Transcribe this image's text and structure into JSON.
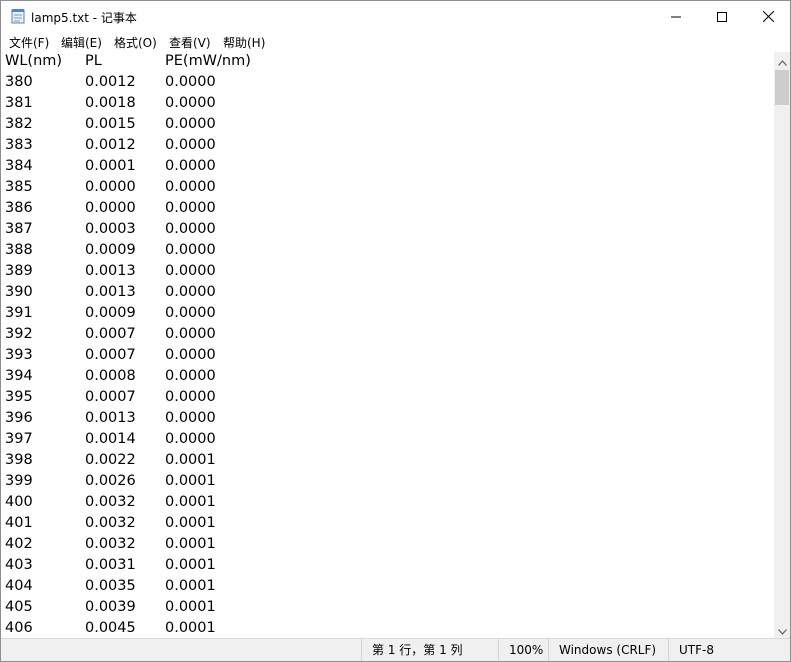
{
  "window": {
    "title": "lamp5.txt - 记事本",
    "icon": "notepad-icon",
    "controls": [
      "minimize-icon",
      "maximize-icon",
      "close-icon"
    ]
  },
  "menu": [
    "文件(F)",
    "编辑(E)",
    "格式(O)",
    "查看(V)",
    "帮助(H)"
  ],
  "document": {
    "header": [
      "WL(nm)",
      "PL",
      "PE(mW/nm)"
    ],
    "rows": [
      [
        "380",
        "0.0012",
        "0.0000"
      ],
      [
        "381",
        "0.0018",
        "0.0000"
      ],
      [
        "382",
        "0.0015",
        "0.0000"
      ],
      [
        "383",
        "0.0012",
        "0.0000"
      ],
      [
        "384",
        "0.0001",
        "0.0000"
      ],
      [
        "385",
        "0.0000",
        "0.0000"
      ],
      [
        "386",
        "0.0000",
        "0.0000"
      ],
      [
        "387",
        "0.0003",
        "0.0000"
      ],
      [
        "388",
        "0.0009",
        "0.0000"
      ],
      [
        "389",
        "0.0013",
        "0.0000"
      ],
      [
        "390",
        "0.0013",
        "0.0000"
      ],
      [
        "391",
        "0.0009",
        "0.0000"
      ],
      [
        "392",
        "0.0007",
        "0.0000"
      ],
      [
        "393",
        "0.0007",
        "0.0000"
      ],
      [
        "394",
        "0.0008",
        "0.0000"
      ],
      [
        "395",
        "0.0007",
        "0.0000"
      ],
      [
        "396",
        "0.0013",
        "0.0000"
      ],
      [
        "397",
        "0.0014",
        "0.0000"
      ],
      [
        "398",
        "0.0022",
        "0.0001"
      ],
      [
        "399",
        "0.0026",
        "0.0001"
      ],
      [
        "400",
        "0.0032",
        "0.0001"
      ],
      [
        "401",
        "0.0032",
        "0.0001"
      ],
      [
        "402",
        "0.0032",
        "0.0001"
      ],
      [
        "403",
        "0.0031",
        "0.0001"
      ],
      [
        "404",
        "0.0035",
        "0.0001"
      ],
      [
        "405",
        "0.0039",
        "0.0001"
      ],
      [
        "406",
        "0.0045",
        "0.0001"
      ]
    ]
  },
  "status": {
    "position": "第 1 行，第 1 列",
    "zoom": "100%",
    "line_ending": "Windows (CRLF)",
    "encoding": "UTF-8"
  },
  "colors": {
    "window_bg": "#ffffff",
    "statusbar_bg": "#f0f0f0",
    "scroll_thumb": "#cdcdcd"
  }
}
